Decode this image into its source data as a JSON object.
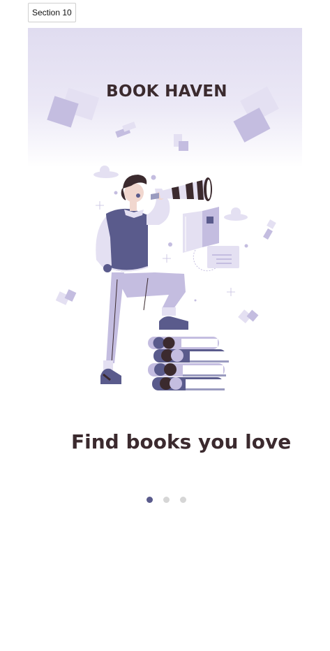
{
  "section": {
    "label": "Section 10"
  },
  "hero": {
    "brand_title": "BOOK HAVEN"
  },
  "onboarding": {
    "headline": "Find books you love",
    "pagination": {
      "total": 3,
      "active_index": 0
    }
  },
  "colors": {
    "primary": "#5a5b8c",
    "text_dark": "#3b2a2e",
    "lavender": "#c4bde0",
    "lavender_light": "#e0dcf0",
    "dot_inactive": "#d6d6d6"
  },
  "icons": {
    "illustration": "man-with-telescope-on-books-illustration"
  }
}
